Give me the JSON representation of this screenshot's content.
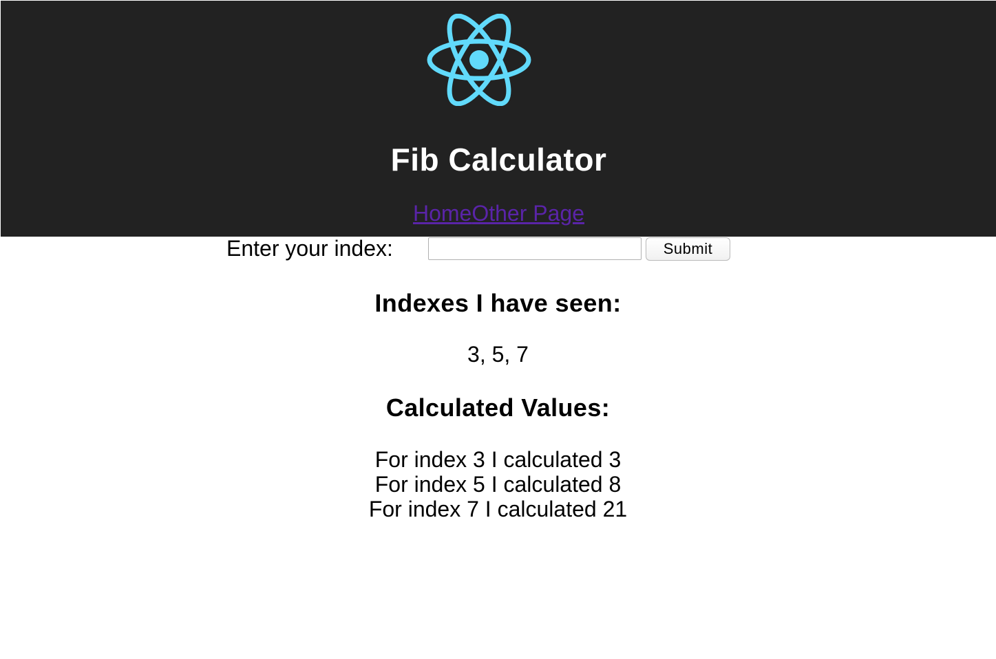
{
  "header": {
    "logo_icon": "react-atom-icon",
    "logo_color": "#61dafb",
    "background": "#222222",
    "title": "Fib Calculator",
    "nav": {
      "home_label": "Home",
      "other_label": "Other Page",
      "link_color": "#5a24a8"
    }
  },
  "form": {
    "label": "Enter your index:",
    "input_value": "",
    "input_placeholder": "",
    "submit_label": "Submit"
  },
  "seen": {
    "heading": "Indexes I have seen:",
    "values_text": "3, 5, 7"
  },
  "calculated": {
    "heading": "Calculated Values:",
    "rows": [
      "For index 3 I calculated 3",
      "For index 5 I calculated 8",
      "For index 7 I calculated 21"
    ]
  }
}
